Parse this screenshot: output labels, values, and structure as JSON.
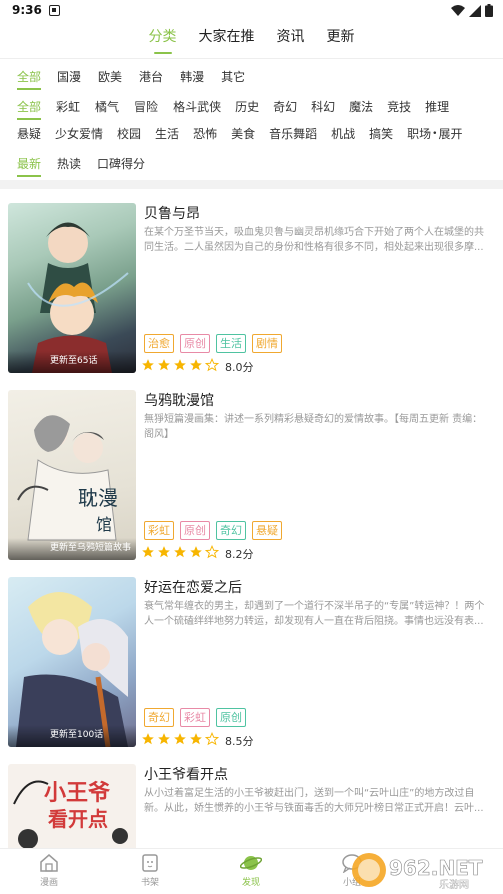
{
  "status_bar": {
    "time": "9:36"
  },
  "top_tabs": [
    {
      "label": "分类",
      "active": true
    },
    {
      "label": "大家在推",
      "active": false
    },
    {
      "label": "资讯",
      "active": false
    },
    {
      "label": "更新",
      "active": false
    }
  ],
  "region_filters": [
    "全部",
    "国漫",
    "欧美",
    "港台",
    "韩漫",
    "其它"
  ],
  "genre_filters_row1": [
    "全部",
    "彩虹",
    "橘气",
    "冒险",
    "格斗武侠",
    "历史",
    "奇幻",
    "科幻",
    "魔法",
    "竞技",
    "推理"
  ],
  "genre_filters_row2": [
    "悬疑",
    "少女爱情",
    "校园",
    "生活",
    "恐怖",
    "美食",
    "音乐舞蹈",
    "机战",
    "搞笑",
    "职场"
  ],
  "expand_label": "展开",
  "sort_filters": [
    "最新",
    "热读",
    "口碑得分"
  ],
  "comics": [
    {
      "title": "贝鲁与昂",
      "desc": "在某个万圣节当天，吸血鬼贝鲁与幽灵昂机缘巧合下开始了两个人在城堡的共同生活。二人虽然因为自己的身份和性格有很多不同，相处起来出现很多摩...",
      "update": "更新至65话",
      "tags": [
        {
          "label": "治愈",
          "color": "#f0a830"
        },
        {
          "label": "原创",
          "color": "#e88aa6"
        },
        {
          "label": "生活",
          "color": "#4fc3a1"
        },
        {
          "label": "剧情",
          "color": "#f0a830"
        }
      ],
      "stars": 4,
      "score": "8.0分"
    },
    {
      "title": "乌鸦耽漫馆",
      "desc": "無猙短篇漫画集：讲述一系列精彩悬疑奇幻的爱情故事。【每周五更新 责编：阁风】",
      "update": "更新至乌鸦短篇故事集",
      "tags": [
        {
          "label": "彩虹",
          "color": "#f0a830"
        },
        {
          "label": "原创",
          "color": "#e88aa6"
        },
        {
          "label": "奇幻",
          "color": "#4fc3a1"
        },
        {
          "label": "悬疑",
          "color": "#f0a830"
        }
      ],
      "stars": 4,
      "score": "8.2分"
    },
    {
      "title": "好运在恋爱之后",
      "desc": "衰气常年缠衣的男主，却遇到了一个道行不深半吊子的“专属”转运神？！两个人一个硫磕绊绊地努力转运，却发现有人一直在背后阻挠。事情也远没有表...",
      "update": "更新至100话",
      "tags": [
        {
          "label": "奇幻",
          "color": "#f0a830"
        },
        {
          "label": "彩虹",
          "color": "#e88aa6"
        },
        {
          "label": "原创",
          "color": "#4fc3a1"
        }
      ],
      "stars": 4,
      "score": "8.5分"
    },
    {
      "title": "小王爷看开点",
      "desc": "从小过着富足生活的小王爷被赶出门，送到一个叫“云叶山庄”的地方改过自新。从此，娇生惯养的小王爷与铁面毒舌的大师兄叶榜日常正式开启！云叶...",
      "update": "",
      "tags": [],
      "stars": 0,
      "score": ""
    }
  ],
  "bottom_nav": [
    {
      "label": "漫画",
      "active": false
    },
    {
      "label": "书架",
      "active": false
    },
    {
      "label": "发现",
      "active": true
    },
    {
      "label": "小组",
      "active": false
    }
  ],
  "watermark": "962.NET 乐游网",
  "accent_color": "#8bc34a"
}
